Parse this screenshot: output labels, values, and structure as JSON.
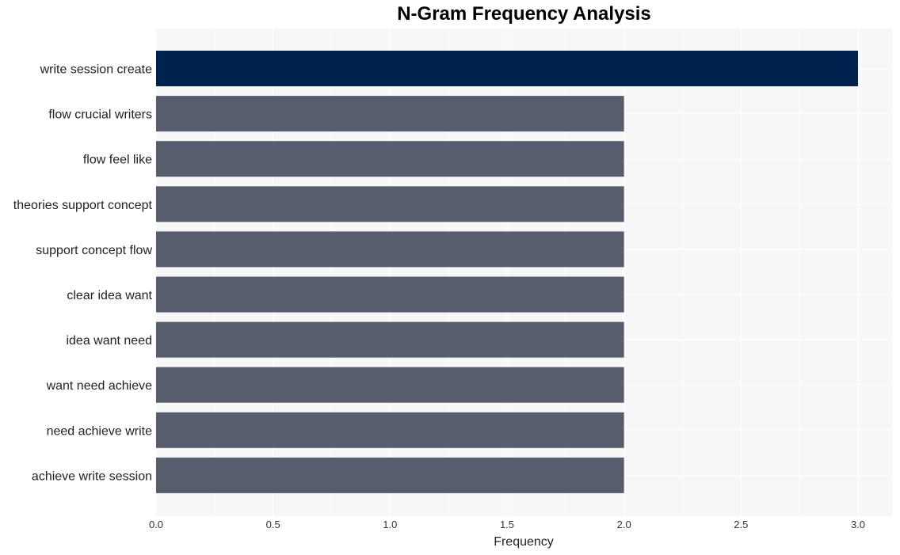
{
  "chart_data": {
    "type": "bar",
    "orientation": "horizontal",
    "title": "N-Gram Frequency Analysis",
    "xlabel": "Frequency",
    "ylabel": "",
    "xlim": [
      0,
      3.15
    ],
    "xticks": [
      0.0,
      0.5,
      1.0,
      1.5,
      2.0,
      2.5,
      3.0
    ],
    "xtick_labels": [
      "0.0",
      "0.5",
      "1.0",
      "1.5",
      "2.0",
      "2.5",
      "3.0"
    ],
    "grid": true,
    "categories": [
      "write session create",
      "flow crucial writers",
      "flow feel like",
      "theories support concept",
      "support concept flow",
      "clear idea want",
      "idea want need",
      "want need achieve",
      "need achieve write",
      "achieve write session"
    ],
    "values": [
      3,
      2,
      2,
      2,
      2,
      2,
      2,
      2,
      2,
      2
    ],
    "colors": {
      "highlight": "#00224e",
      "default": "#575d6d",
      "plot_background": "#f7f7f7",
      "grid": "#ffffff"
    }
  }
}
